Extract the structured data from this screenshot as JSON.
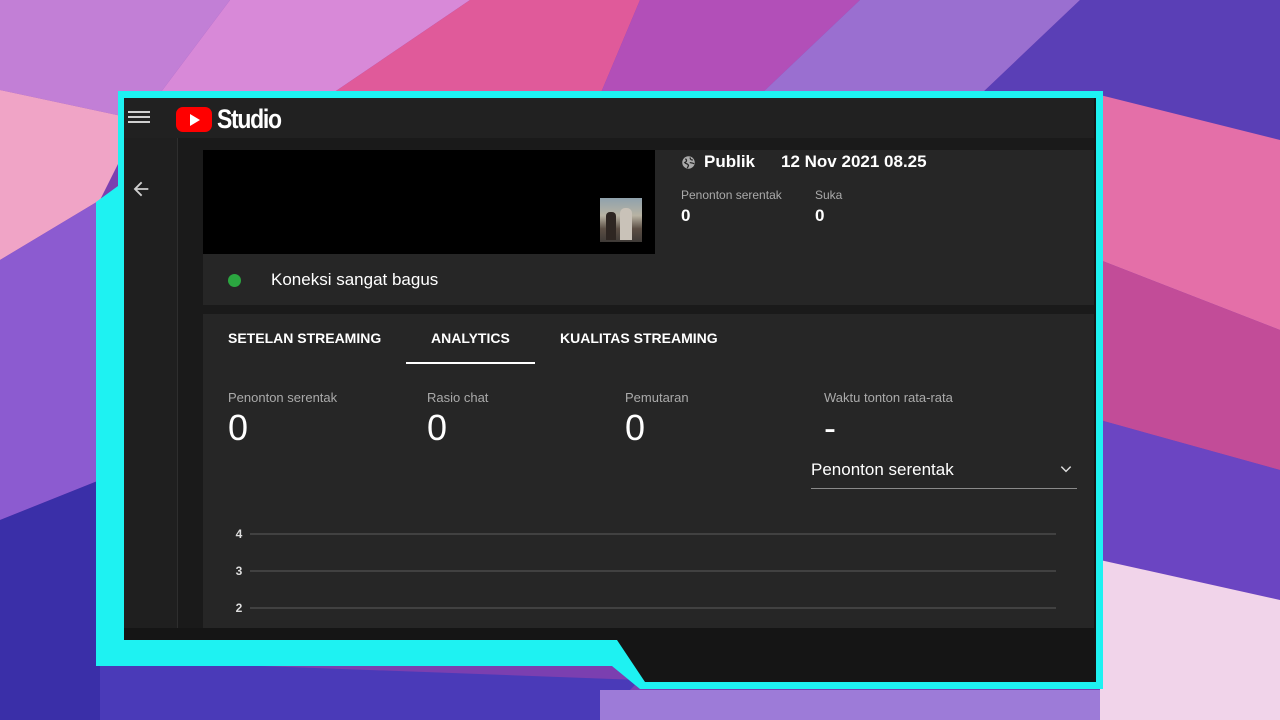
{
  "app": {
    "logo_text": "Studio"
  },
  "stream": {
    "visibility": "Publik",
    "date": "12 Nov 2021 08.25",
    "stats": [
      {
        "label": "Penonton serentak",
        "value": "0"
      },
      {
        "label": "Suka",
        "value": "0"
      }
    ],
    "connection": {
      "status": "Koneksi sangat bagus",
      "color": "#2ba640"
    }
  },
  "tabs": [
    {
      "label": "SETELAN STREAMING",
      "active": false
    },
    {
      "label": "ANALYTICS",
      "active": true
    },
    {
      "label": "KUALITAS STREAMING",
      "active": false
    }
  ],
  "metrics": [
    {
      "label": "Penonton serentak",
      "value": "0"
    },
    {
      "label": "Rasio chat",
      "value": "0"
    },
    {
      "label": "Pemutaran",
      "value": "0"
    },
    {
      "label": "Waktu tonton rata-rata",
      "value": "-"
    }
  ],
  "metric_select": {
    "value": "Penonton serentak"
  },
  "chart_data": {
    "type": "line",
    "y_ticks": [
      "4",
      "3",
      "2"
    ],
    "series": [],
    "grid": true
  },
  "icons": [
    "menu-icon",
    "youtube-logo-icon",
    "back-arrow-icon",
    "globe-icon",
    "chevron-down-icon"
  ],
  "colors": {
    "accent": "#ff0000",
    "frame": "#1ef2f2",
    "status_ok": "#2ba640"
  }
}
